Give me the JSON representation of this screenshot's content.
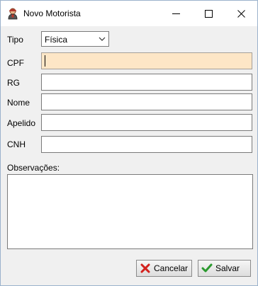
{
  "window": {
    "title": "Novo Motorista",
    "icon": "driver-app-icon",
    "controls": [
      "minimize-icon",
      "maximize-icon",
      "close-icon"
    ]
  },
  "form": {
    "tipo": {
      "label": "Tipo",
      "value": "Física",
      "icon": "chevron-down-icon"
    },
    "cpf": {
      "label": "CPF",
      "value": "",
      "focused": true,
      "focus_color": "#fde6c6"
    },
    "rg": {
      "label": "RG",
      "value": ""
    },
    "nome": {
      "label": "Nome",
      "value": ""
    },
    "apelido": {
      "label": "Apelido",
      "value": ""
    },
    "cnh": {
      "label": "CNH",
      "value": ""
    },
    "observacoes": {
      "label": "Observações:",
      "value": ""
    }
  },
  "buttons": {
    "cancel": {
      "label": "Cancelar",
      "icon": "x-icon",
      "icon_color": "#d3211d"
    },
    "save": {
      "label": "Salvar",
      "icon": "checkmark-icon",
      "icon_color": "#2b9a2f"
    }
  }
}
